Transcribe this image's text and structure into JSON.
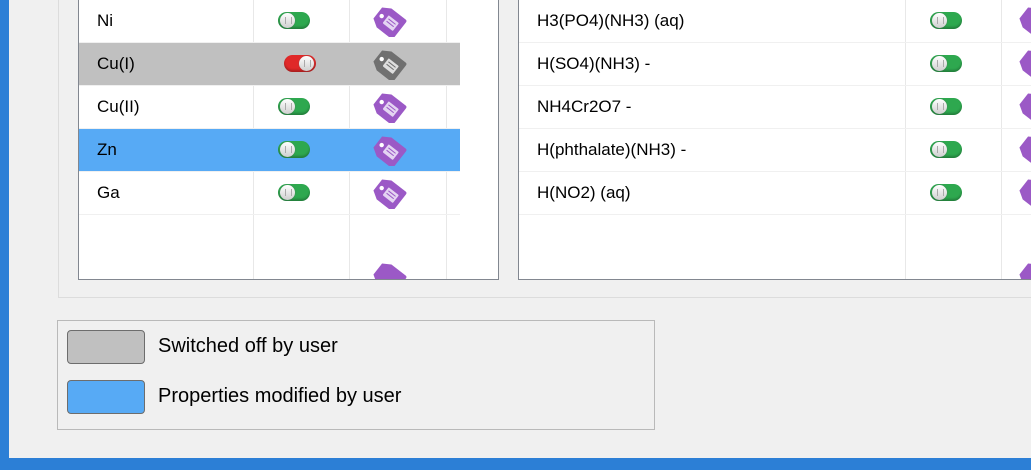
{
  "colors": {
    "frame": "#2c7fd6",
    "switched_off_row": "#c0c0c0",
    "modified_row": "#57aaf5",
    "toggle_on": "#2ea84f",
    "toggle_off": "#e02828",
    "tag_purple": "#9b59c6",
    "tag_gray": "#707070"
  },
  "left_table": {
    "rows": [
      {
        "name": "Ni",
        "state": "normal",
        "enabled": true
      },
      {
        "name": "Cu(I)",
        "state": "switched-off",
        "enabled": false
      },
      {
        "name": "Cu(II)",
        "state": "normal",
        "enabled": true
      },
      {
        "name": "Zn",
        "state": "modified",
        "enabled": true
      },
      {
        "name": "Ga",
        "state": "normal",
        "enabled": true
      }
    ],
    "scroll_down_icon": "chevron-down-icon"
  },
  "right_table": {
    "rows": [
      {
        "name": "H3(PO4)(NH3) (aq)",
        "enabled": true
      },
      {
        "name": "H(SO4)(NH3) -",
        "enabled": true
      },
      {
        "name": "NH4Cr2O7 -",
        "enabled": true
      },
      {
        "name": "H(phthalate)(NH3) -",
        "enabled": true
      },
      {
        "name": "H(NO2) (aq)",
        "enabled": true
      }
    ]
  },
  "legend": {
    "switched_off": "Switched off by user",
    "modified": "Properties modified by user"
  },
  "icons": {
    "toggle": "toggle-switch-icon",
    "properties": "tag-icon"
  }
}
